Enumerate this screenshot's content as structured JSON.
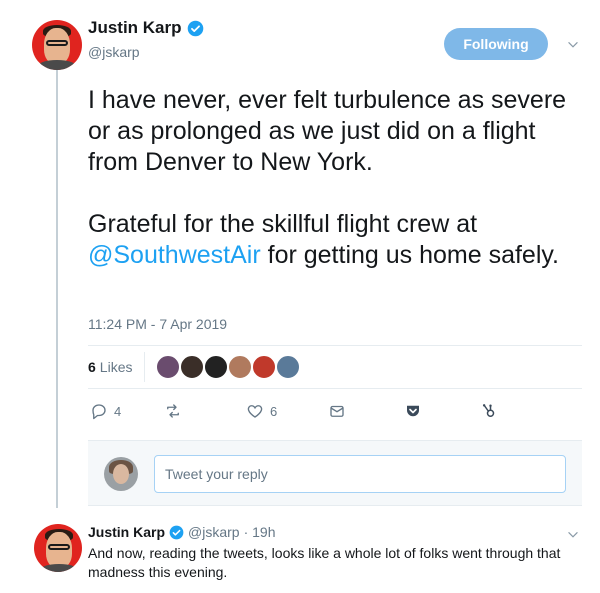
{
  "tweet": {
    "author_name": "Justin Karp",
    "author_handle": "@jskarp",
    "follow_label": "Following",
    "text_p1": "I have never, ever felt turbulence as severe or as prolonged as we just did on a flight from Denver to New York.",
    "text_p2_before": "Grateful for the skillful flight crew at ",
    "text_p2_mention": "@SouthwestAir",
    "text_p2_after": " for getting us home safely.",
    "timestamp": "11:24 PM - 7 Apr 2019",
    "likes_count": "6",
    "likes_label": "Likes",
    "liker_colors": [
      "#6a4c6e",
      "#3a2e28",
      "#222222",
      "#b07a5e",
      "#c0392b",
      "#5a7a99"
    ]
  },
  "actions": {
    "reply_count": "4",
    "retweet_count": "",
    "like_count": "6"
  },
  "reply_box": {
    "placeholder": "Tweet your reply"
  },
  "reply": {
    "author_name": "Justin Karp",
    "author_handle": "@jskarp",
    "time": "· 19h",
    "text": "And now, reading the tweets, looks like a whole lot of folks went through that madness this evening."
  },
  "colors": {
    "accent": "#1da1f2",
    "follow_bg": "#7fb8e8",
    "muted": "#657786"
  }
}
